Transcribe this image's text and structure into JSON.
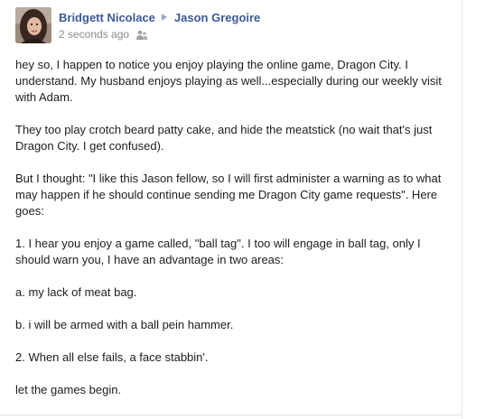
{
  "post": {
    "author": "Bridgett Nicolace",
    "recipient": "Jason Gregoire",
    "timestamp": "2 seconds ago",
    "privacy_icon": "people-icon",
    "paragraphs": [
      "hey so, I happen to notice you enjoy playing the online game, Dragon City. I understand. My husband enjoys playing as well...especially during our weekly visit with Adam.",
      "They too play crotch beard patty cake, and hide the meatstick (no wait that's just Dragon City. I get confused).",
      "But I thought: \"I like this Jason fellow, so I will first administer a warning as to what may happen if he should continue sending me Dragon City game requests\". Here goes:",
      "1. I hear you enjoy a game called, \"ball tag\". I too will engage in ball tag, only I should warn you, I have an advantage in two areas:",
      "a. my lack of meat bag.",
      "b. i will be armed with a ball pein hammer.",
      "2. When all else fails, a face stabbin'.",
      "let the games begin."
    ]
  },
  "colors": {
    "link": "#3b5998",
    "meta": "#8c8c8c",
    "text": "#1d1d1d",
    "border": "#dfe3ee"
  }
}
